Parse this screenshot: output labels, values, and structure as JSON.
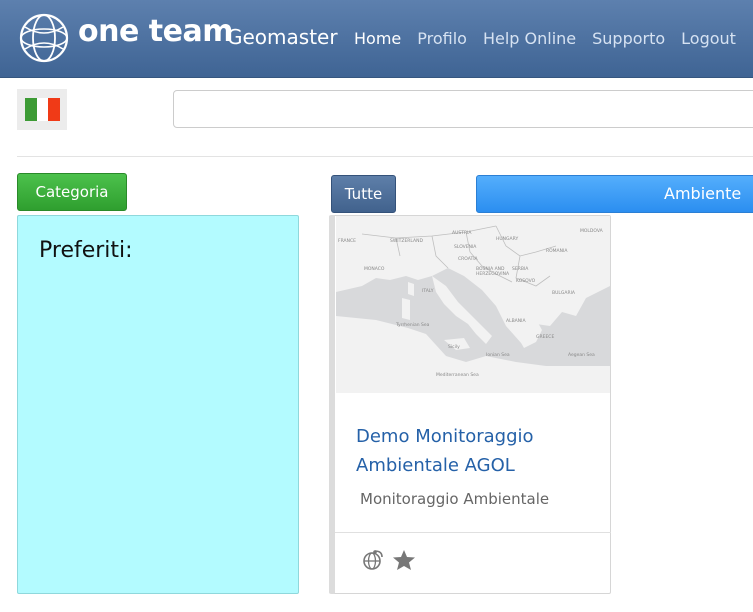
{
  "header": {
    "brand": "one team",
    "product": "Geomaster",
    "nav": [
      {
        "label": "Home",
        "active": true
      },
      {
        "label": "Profilo"
      },
      {
        "label": "Help Online"
      },
      {
        "label": "Supporto"
      },
      {
        "label": "Logout"
      }
    ],
    "colors": {
      "bar": "#4a6d9b"
    }
  },
  "language": {
    "flag": "italy-flag-icon",
    "colors": [
      "#3d9b35",
      "#ffffff",
      "#f03a17"
    ]
  },
  "search": {
    "value": "",
    "placeholder": ""
  },
  "buttons": {
    "category": "Categoria",
    "all": "Tutte",
    "environment": "Ambiente"
  },
  "favorites": {
    "title": "Preferiti:",
    "color": "#b3fbff"
  },
  "card": {
    "title": "Demo Monitoraggio Ambientale AGOL",
    "category": "Monitoraggio Ambientale",
    "map_labels": [
      "FRANCE",
      "SWITZERLAND",
      "AUSTRIA",
      "HUNGARY",
      "ROMANIA",
      "MOLDOVA",
      "SLOVENIA",
      "CROATIA",
      "BOSNIA AND HERZEGOVINA",
      "SERBIA",
      "ITALY",
      "BULGARIA",
      "KOSOVO",
      "ALBANIA",
      "MONACO",
      "Tyrrhenian Sea",
      "Mediterranean Sea",
      "GREECE",
      "Ionian Sea",
      "Aegean Sea",
      "Sicily"
    ],
    "icons": [
      "globe-link-icon",
      "star-icon"
    ]
  }
}
